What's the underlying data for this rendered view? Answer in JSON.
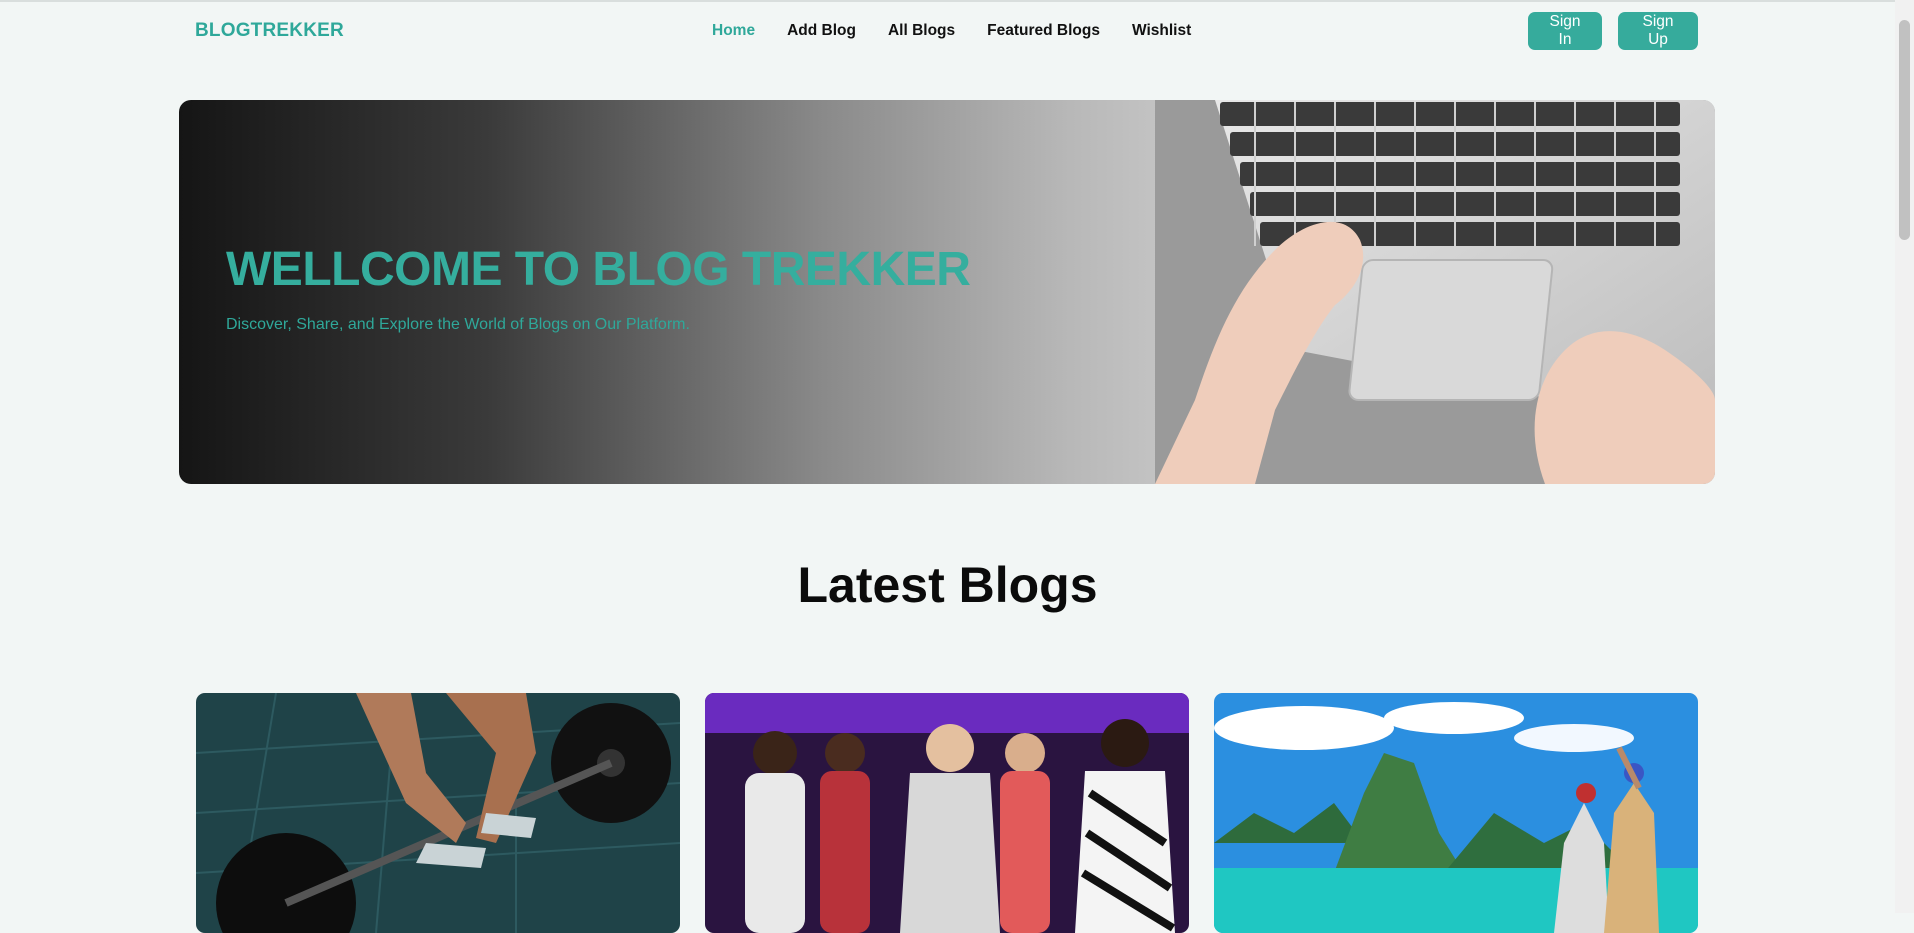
{
  "brand": {
    "logo": "BLOGTREKKER",
    "accent": "#36ab9c"
  },
  "nav": {
    "links": [
      {
        "label": "Home",
        "active": true
      },
      {
        "label": "Add Blog",
        "active": false
      },
      {
        "label": "All Blogs",
        "active": false
      },
      {
        "label": "Featured Blogs",
        "active": false
      },
      {
        "label": "Wishlist",
        "active": false
      }
    ],
    "signin_label": "Sign In",
    "signup_label": "Sign Up"
  },
  "hero": {
    "title": "WELLCOME TO BLOG TREKKER",
    "subtitle": "Discover, Share, and Explore the World of Blogs on Our Platform."
  },
  "latest": {
    "title": "Latest Blogs",
    "cards": [
      {
        "image": "weightlifting-barbell-photo"
      },
      {
        "image": "fashion-runway-photo"
      },
      {
        "image": "travel-island-boat-photo"
      }
    ]
  }
}
